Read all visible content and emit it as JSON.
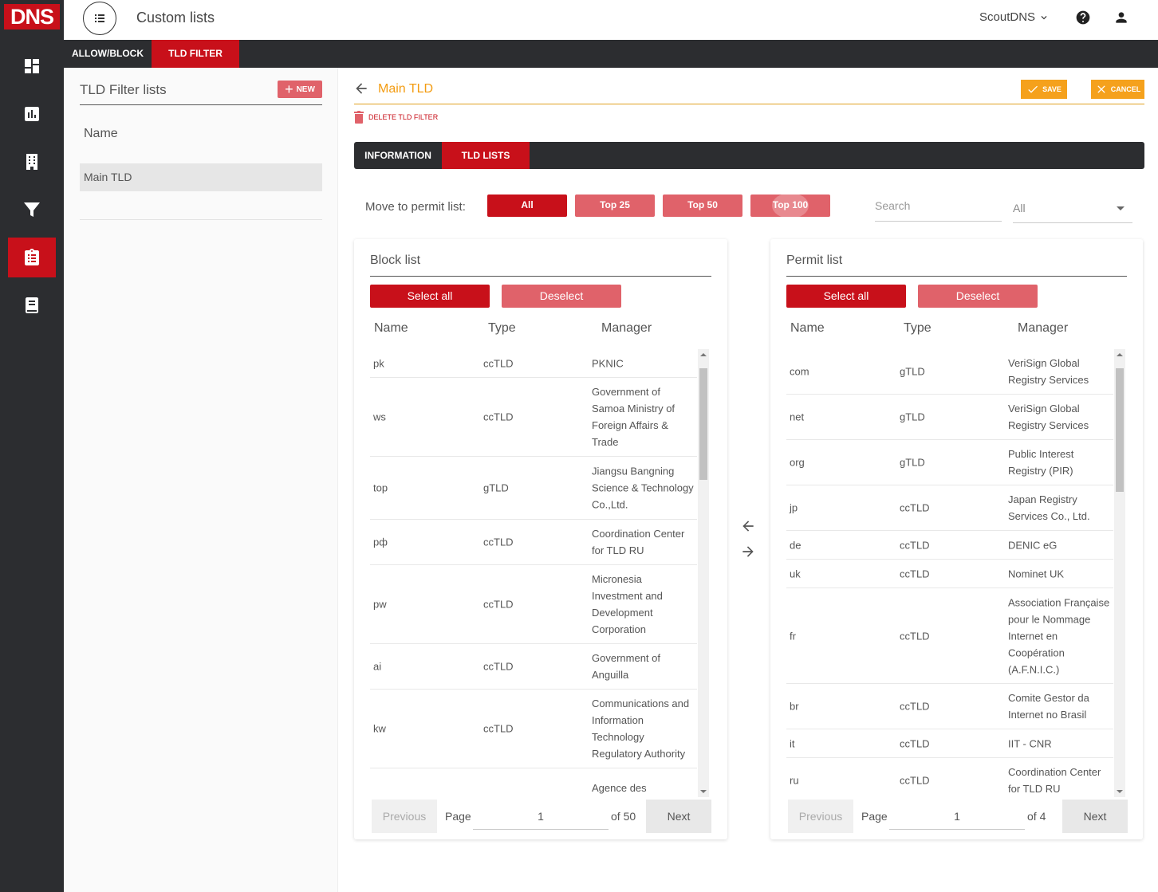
{
  "app": {
    "logo": "DNS",
    "page_title": "Custom lists",
    "account": "ScoutDNS"
  },
  "sidebar": {
    "items": [
      {
        "icon": "dashboard-icon"
      },
      {
        "icon": "reports-icon"
      },
      {
        "icon": "building-icon"
      },
      {
        "icon": "filter-icon"
      },
      {
        "icon": "clipboard-list-icon",
        "active": true
      },
      {
        "icon": "book-icon"
      }
    ]
  },
  "tabs": [
    {
      "label": "ALLOW/BLOCK"
    },
    {
      "label": "TLD FILTER",
      "active": true
    }
  ],
  "left_panel": {
    "title": "TLD Filter lists",
    "new_label": "NEW",
    "name_header": "Name",
    "items": [
      "Main TLD"
    ]
  },
  "editor": {
    "title": "Main TLD",
    "save_label": "SAVE",
    "cancel_label": "CANCEL",
    "delete_label": "DELETE TLD FILTER",
    "subtabs": [
      {
        "label": "INFORMATION"
      },
      {
        "label": "TLD LISTS",
        "active": true
      }
    ],
    "move_label": "Move to permit list:",
    "move_buttons": [
      "All",
      "Top 25",
      "Top 50",
      "Top 100"
    ],
    "search_placeholder": "Search",
    "type_select": "All"
  },
  "block_list": {
    "title": "Block list",
    "select_all": "Select all",
    "deselect": "Deselect",
    "columns": [
      "Name",
      "Type",
      "Manager"
    ],
    "rows": [
      {
        "name": "pk",
        "type": "ccTLD",
        "manager": "PKNIC"
      },
      {
        "name": "ws",
        "type": "ccTLD",
        "manager": "Government of Samoa Ministry of Foreign Affairs & Trade"
      },
      {
        "name": "top",
        "type": "gTLD",
        "manager": "Jiangsu Bangning Science & Technology Co.,Ltd."
      },
      {
        "name": "рф",
        "type": "ccTLD",
        "manager": "Coordination Center for TLD RU"
      },
      {
        "name": "pw",
        "type": "ccTLD",
        "manager": "Micronesia Investment and Development Corporation"
      },
      {
        "name": "ai",
        "type": "ccTLD",
        "manager": "Government of Anguilla"
      },
      {
        "name": "kw",
        "type": "ccTLD",
        "manager": "Communications and Information Technology Regulatory Authority"
      },
      {
        "name": "",
        "type": "",
        "manager": "Agence des Technologies de"
      }
    ],
    "previous": "Previous",
    "next": "Next",
    "page_label": "Page",
    "page": "1",
    "of_label": "of 50",
    "scroll_position": 0.02
  },
  "permit_list": {
    "title": "Permit list",
    "select_all": "Select all",
    "deselect": "Deselect",
    "columns": [
      "Name",
      "Type",
      "Manager"
    ],
    "rows": [
      {
        "name": "com",
        "type": "gTLD",
        "manager": "VeriSign Global Registry Services"
      },
      {
        "name": "net",
        "type": "gTLD",
        "manager": "VeriSign Global Registry Services"
      },
      {
        "name": "org",
        "type": "gTLD",
        "manager": "Public Interest Registry (PIR)"
      },
      {
        "name": "jp",
        "type": "ccTLD",
        "manager": "Japan Registry Services Co., Ltd."
      },
      {
        "name": "de",
        "type": "ccTLD",
        "manager": "DENIC eG"
      },
      {
        "name": "uk",
        "type": "ccTLD",
        "manager": "Nominet UK"
      },
      {
        "name": "fr",
        "type": "ccTLD",
        "manager": "Association Française pour le Nommage Internet en Coopération (A.F.N.I.C.)"
      },
      {
        "name": "br",
        "type": "ccTLD",
        "manager": "Comite Gestor da Internet no Brasil"
      },
      {
        "name": "it",
        "type": "ccTLD",
        "manager": "IIT - CNR"
      },
      {
        "name": "ru",
        "type": "ccTLD",
        "manager": "Coordination Center for TLD RU"
      }
    ],
    "previous": "Previous",
    "next": "Next",
    "page_label": "Page",
    "page": "1",
    "of_label": "of 4",
    "scroll_position": 0.02
  }
}
